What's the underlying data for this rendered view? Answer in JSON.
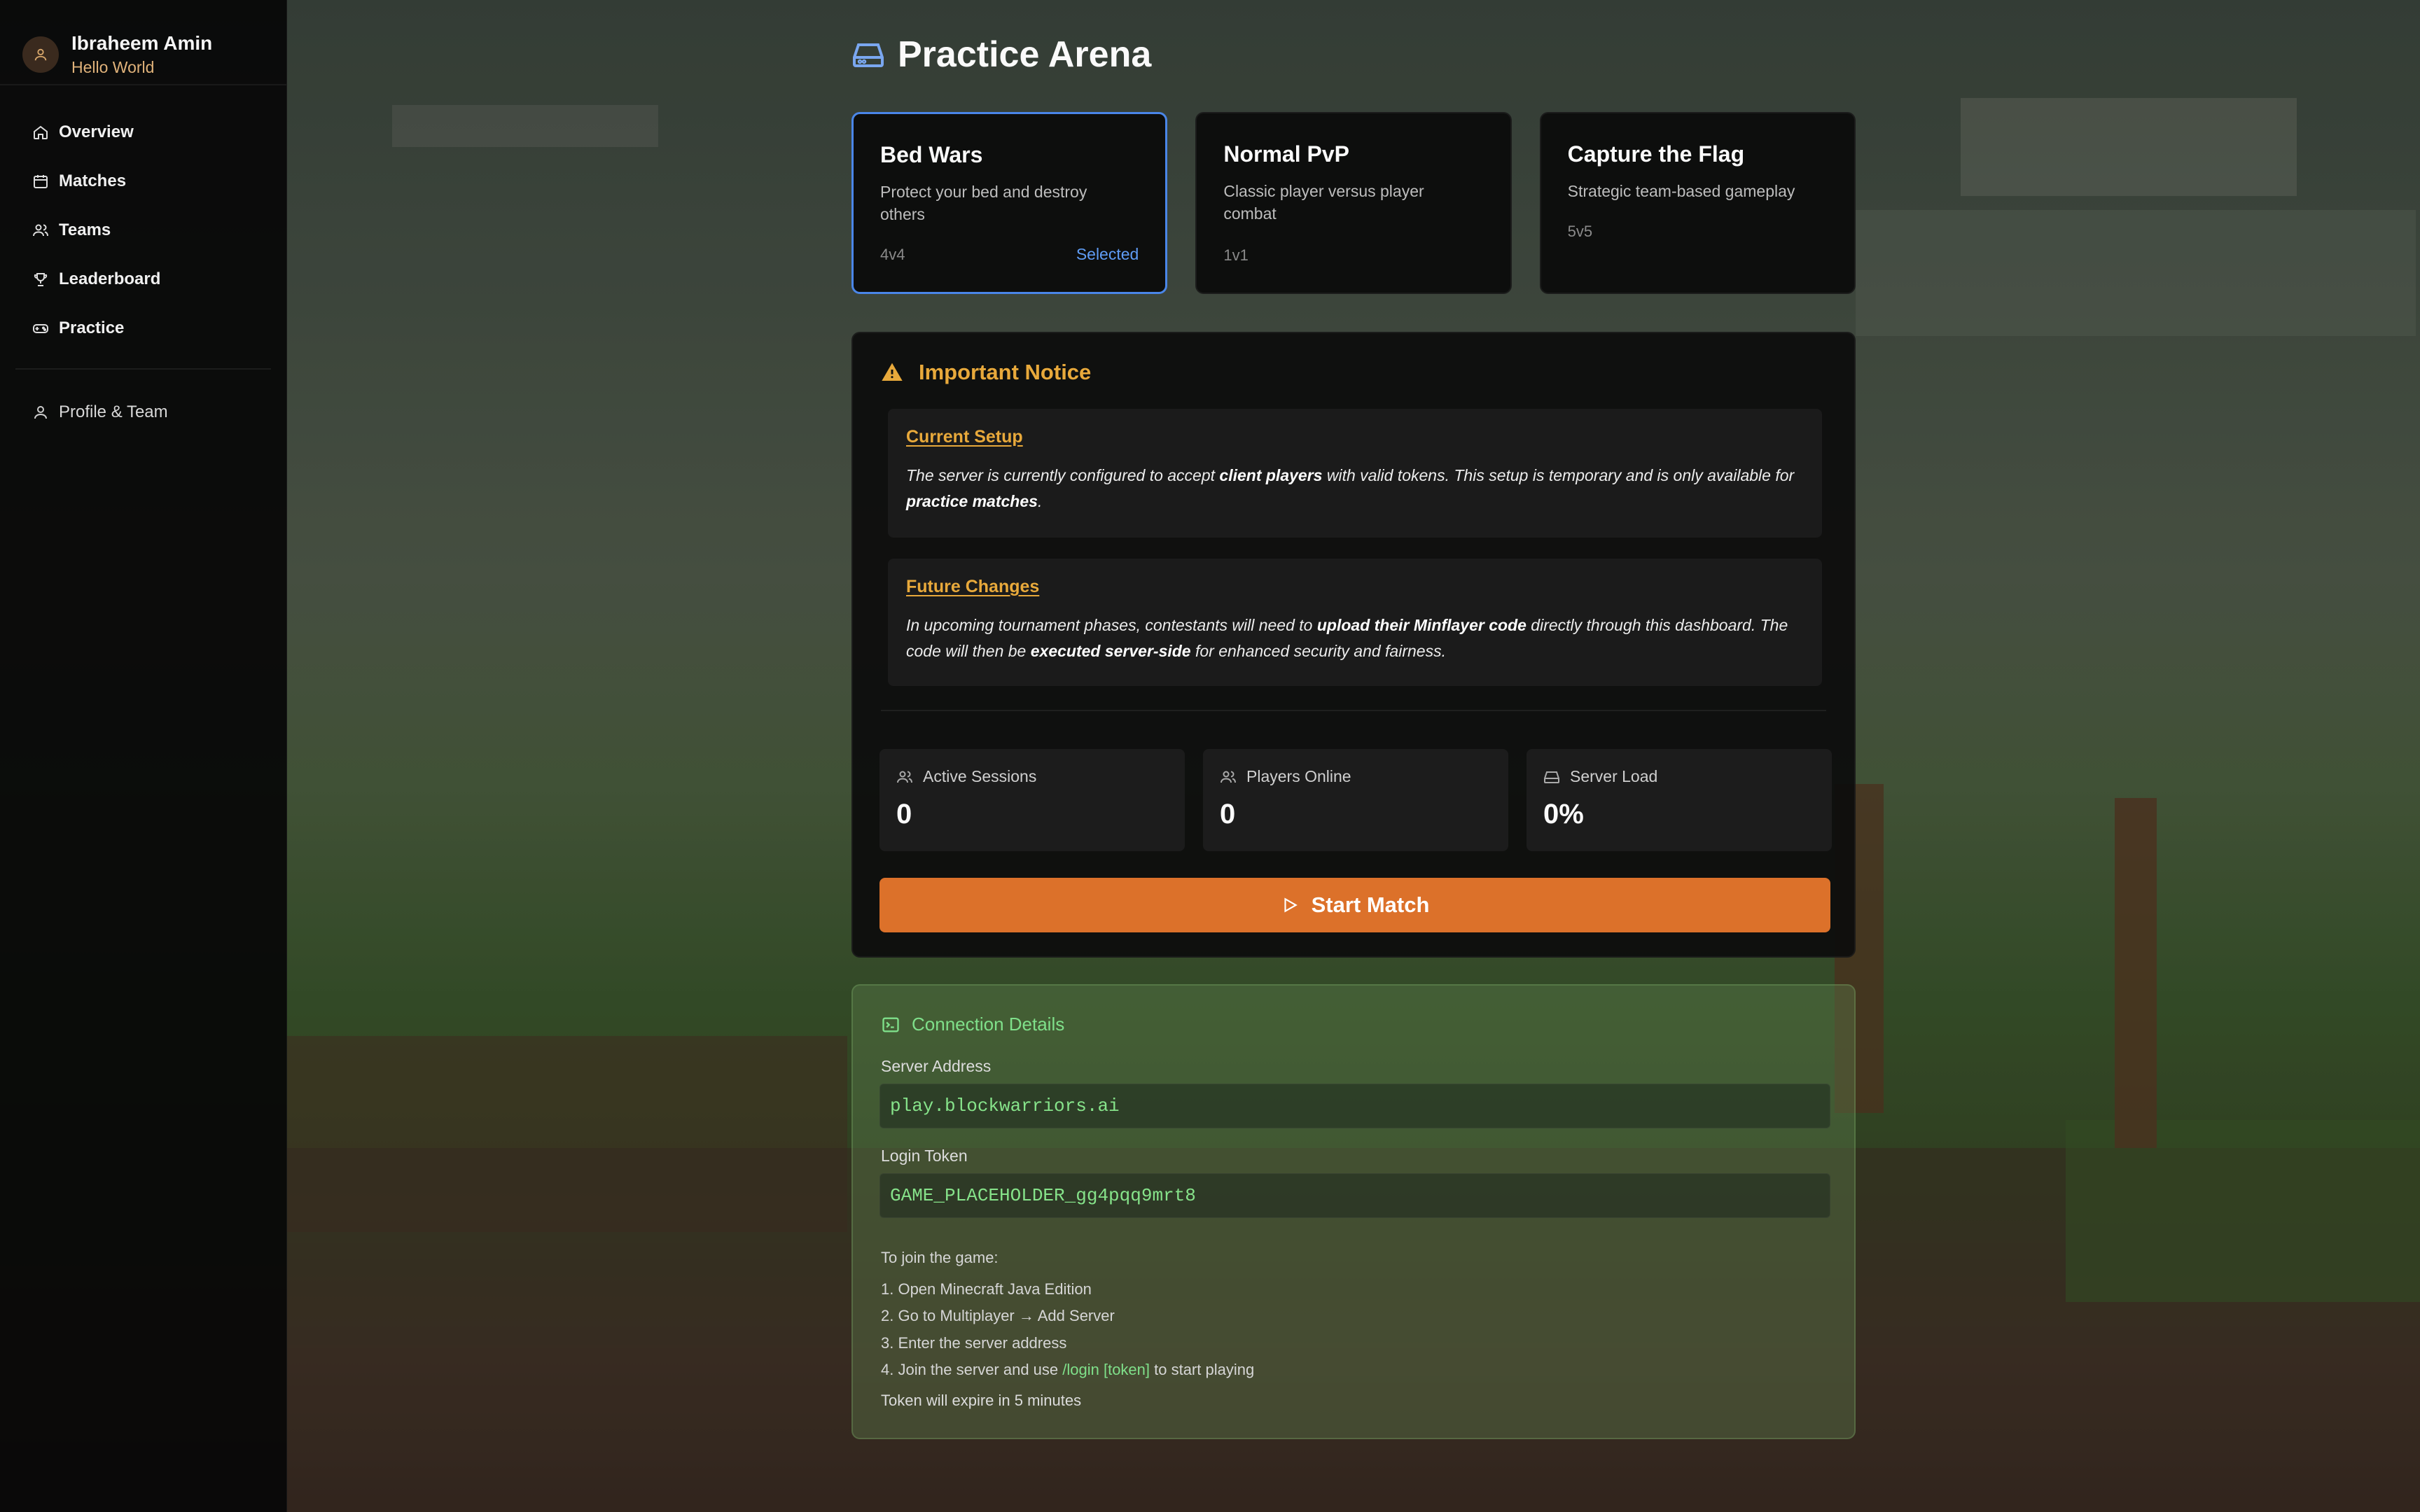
{
  "user": {
    "name": "Ibraheem Amin",
    "subtitle": "Hello World"
  },
  "nav": {
    "items": [
      {
        "label": "Overview",
        "icon": "home-icon"
      },
      {
        "label": "Matches",
        "icon": "calendar-icon"
      },
      {
        "label": "Teams",
        "icon": "users-icon"
      },
      {
        "label": "Leaderboard",
        "icon": "trophy-icon"
      },
      {
        "label": "Practice",
        "icon": "gamepad-icon"
      }
    ],
    "profile": {
      "label": "Profile & Team",
      "icon": "user-icon"
    }
  },
  "page": {
    "title": "Practice Arena",
    "icon": "hard-drive-icon"
  },
  "modes": [
    {
      "title": "Bed Wars",
      "description": "Protect your bed and destroy others",
      "size": "4v4",
      "status": "Selected",
      "selected": true
    },
    {
      "title": "Normal PvP",
      "description": "Classic player versus player combat",
      "size": "1v1",
      "selected": false
    },
    {
      "title": "Capture the Flag",
      "description": "Strategic team-based gameplay",
      "size": "5v5",
      "selected": false
    }
  ],
  "notice": {
    "title": "Important Notice",
    "current": {
      "title": "Current Setup",
      "t1": "The server is currently configured to accept ",
      "b1": "client players",
      "t2": " with valid tokens. This setup is temporary and is only available for ",
      "b2": "practice matches",
      "t3": "."
    },
    "future": {
      "title": "Future Changes",
      "t1": "In upcoming tournament phases, contestants will need to ",
      "b1": "upload their Minflayer code",
      "t2": " directly through this dashboard. The code will then be ",
      "b2": "executed server-side",
      "t3": " for enhanced security and fairness."
    }
  },
  "stats": [
    {
      "label": "Active Sessions",
      "value": "0",
      "icon": "users-icon"
    },
    {
      "label": "Players Online",
      "value": "0",
      "icon": "users-icon"
    },
    {
      "label": "Server Load",
      "value": "0%",
      "icon": "hard-drive-icon"
    }
  ],
  "start_button": "Start Match",
  "connection": {
    "title": "Connection Details",
    "server_label": "Server Address",
    "server_value": "play.blockwarriors.ai",
    "token_label": "Login Token",
    "token_value": "GAME_PLACEHOLDER_gg4pqq9mrt8",
    "instructions_title": "To join the game:",
    "steps": [
      "1. Open Minecraft Java Edition",
      "2. Go to Multiplayer → Add Server",
      "3. Enter the server address"
    ],
    "step4_pre": "4. Join the server and use ",
    "step4_cmd": "/login [token]",
    "step4_post": " to start playing",
    "expire": "Token will expire in 5 minutes"
  },
  "colors": {
    "accent": "#dc712a",
    "warning": "#e8a93b",
    "selected": "#4a86e8",
    "terminal_green": "#7fe08a"
  }
}
